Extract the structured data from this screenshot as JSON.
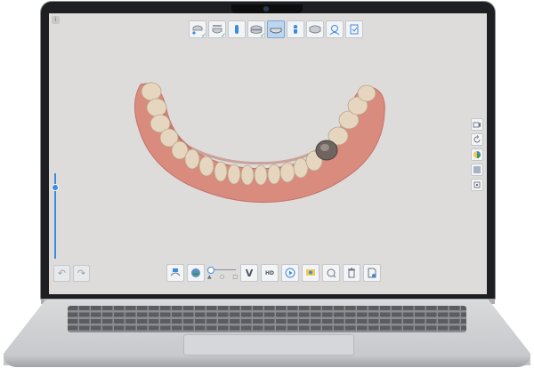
{
  "app": {
    "tag": "i"
  },
  "top_toolbar": {
    "buttons": [
      {
        "icon": "upper-jaw-scan-icon",
        "done": true
      },
      {
        "icon": "lower-jaw-scan-icon",
        "done": true
      },
      {
        "icon": "single-tooth-icon",
        "done": false
      },
      {
        "icon": "bite-scan-icon",
        "done": true
      },
      {
        "icon": "lower-jaw-active-icon",
        "done": false,
        "active": true
      },
      {
        "icon": "implant-tooth-icon",
        "done": false
      },
      {
        "icon": "bite-alignment-icon",
        "done": false
      },
      {
        "icon": "patient-face-icon",
        "done": false
      },
      {
        "icon": "confirm-checklist-icon",
        "done": false
      }
    ],
    "check_mark": "✓"
  },
  "left_panel": {
    "zoom_level": 0.84,
    "undo_glyph": "↶",
    "redo_glyph": "↷"
  },
  "right_toolbar": {
    "buttons": [
      "camera-icon",
      "rotate-icon",
      "color-wheel-icon",
      "texture-toggle-icon",
      "grid-icon"
    ]
  },
  "bottom_toolbar": {
    "buttons": [
      "trim-tool-icon",
      "model-view-icon",
      "brightness-slider",
      "v-tool-icon",
      "hd-icon",
      "play-icon",
      "scan-settings-icon",
      "lock-icon",
      "delete-icon",
      "export-file-icon"
    ],
    "hd_label": "HD",
    "v_label": "V"
  },
  "colors": {
    "accent": "#3d8be0",
    "screen_bg": "#dddcdb",
    "gum": "#d98b7e",
    "tooth": "#e6d6bf",
    "metal_crown": "#6e6560"
  }
}
